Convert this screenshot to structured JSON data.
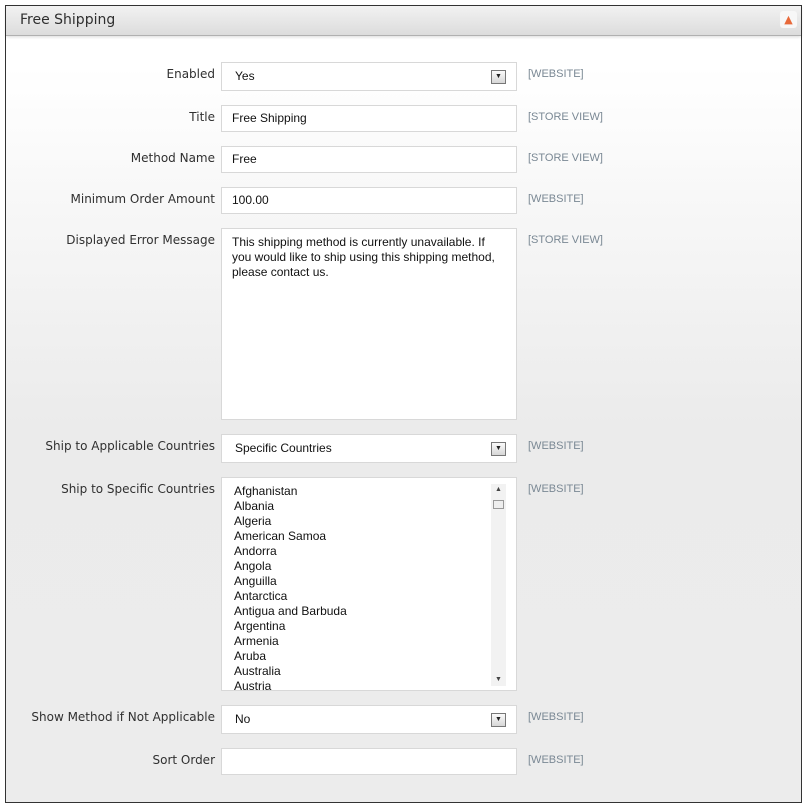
{
  "section": {
    "title": "Free Shipping",
    "collapse_icon": "chevron-up-icon"
  },
  "fields": {
    "enabled": {
      "label": "Enabled",
      "value": "Yes",
      "scope": "[WEBSITE]"
    },
    "title": {
      "label": "Title",
      "value": "Free Shipping",
      "scope": "[STORE VIEW]"
    },
    "method_name": {
      "label": "Method Name",
      "value": "Free",
      "scope": "[STORE VIEW]"
    },
    "min_order": {
      "label": "Minimum Order Amount",
      "value": "100.00",
      "scope": "[WEBSITE]"
    },
    "error_msg": {
      "label": "Displayed Error Message",
      "value": "This shipping method is currently unavailable. If you would like to ship using this shipping method, please contact us.",
      "scope": "[STORE VIEW]"
    },
    "applicable_countries": {
      "label": "Ship to Applicable Countries",
      "value": "Specific Countries",
      "scope": "[WEBSITE]"
    },
    "specific_countries": {
      "label": "Ship to Specific Countries",
      "scope": "[WEBSITE]",
      "options": [
        "Afghanistan",
        "Albania",
        "Algeria",
        "American Samoa",
        "Andorra",
        "Angola",
        "Anguilla",
        "Antarctica",
        "Antigua and Barbuda",
        "Argentina",
        "Armenia",
        "Aruba",
        "Australia",
        "Austria"
      ]
    },
    "show_method": {
      "label": "Show Method if Not Applicable",
      "value": "No",
      "scope": "[WEBSITE]"
    },
    "sort_order": {
      "label": "Sort Order",
      "value": "",
      "scope": "[WEBSITE]"
    }
  }
}
